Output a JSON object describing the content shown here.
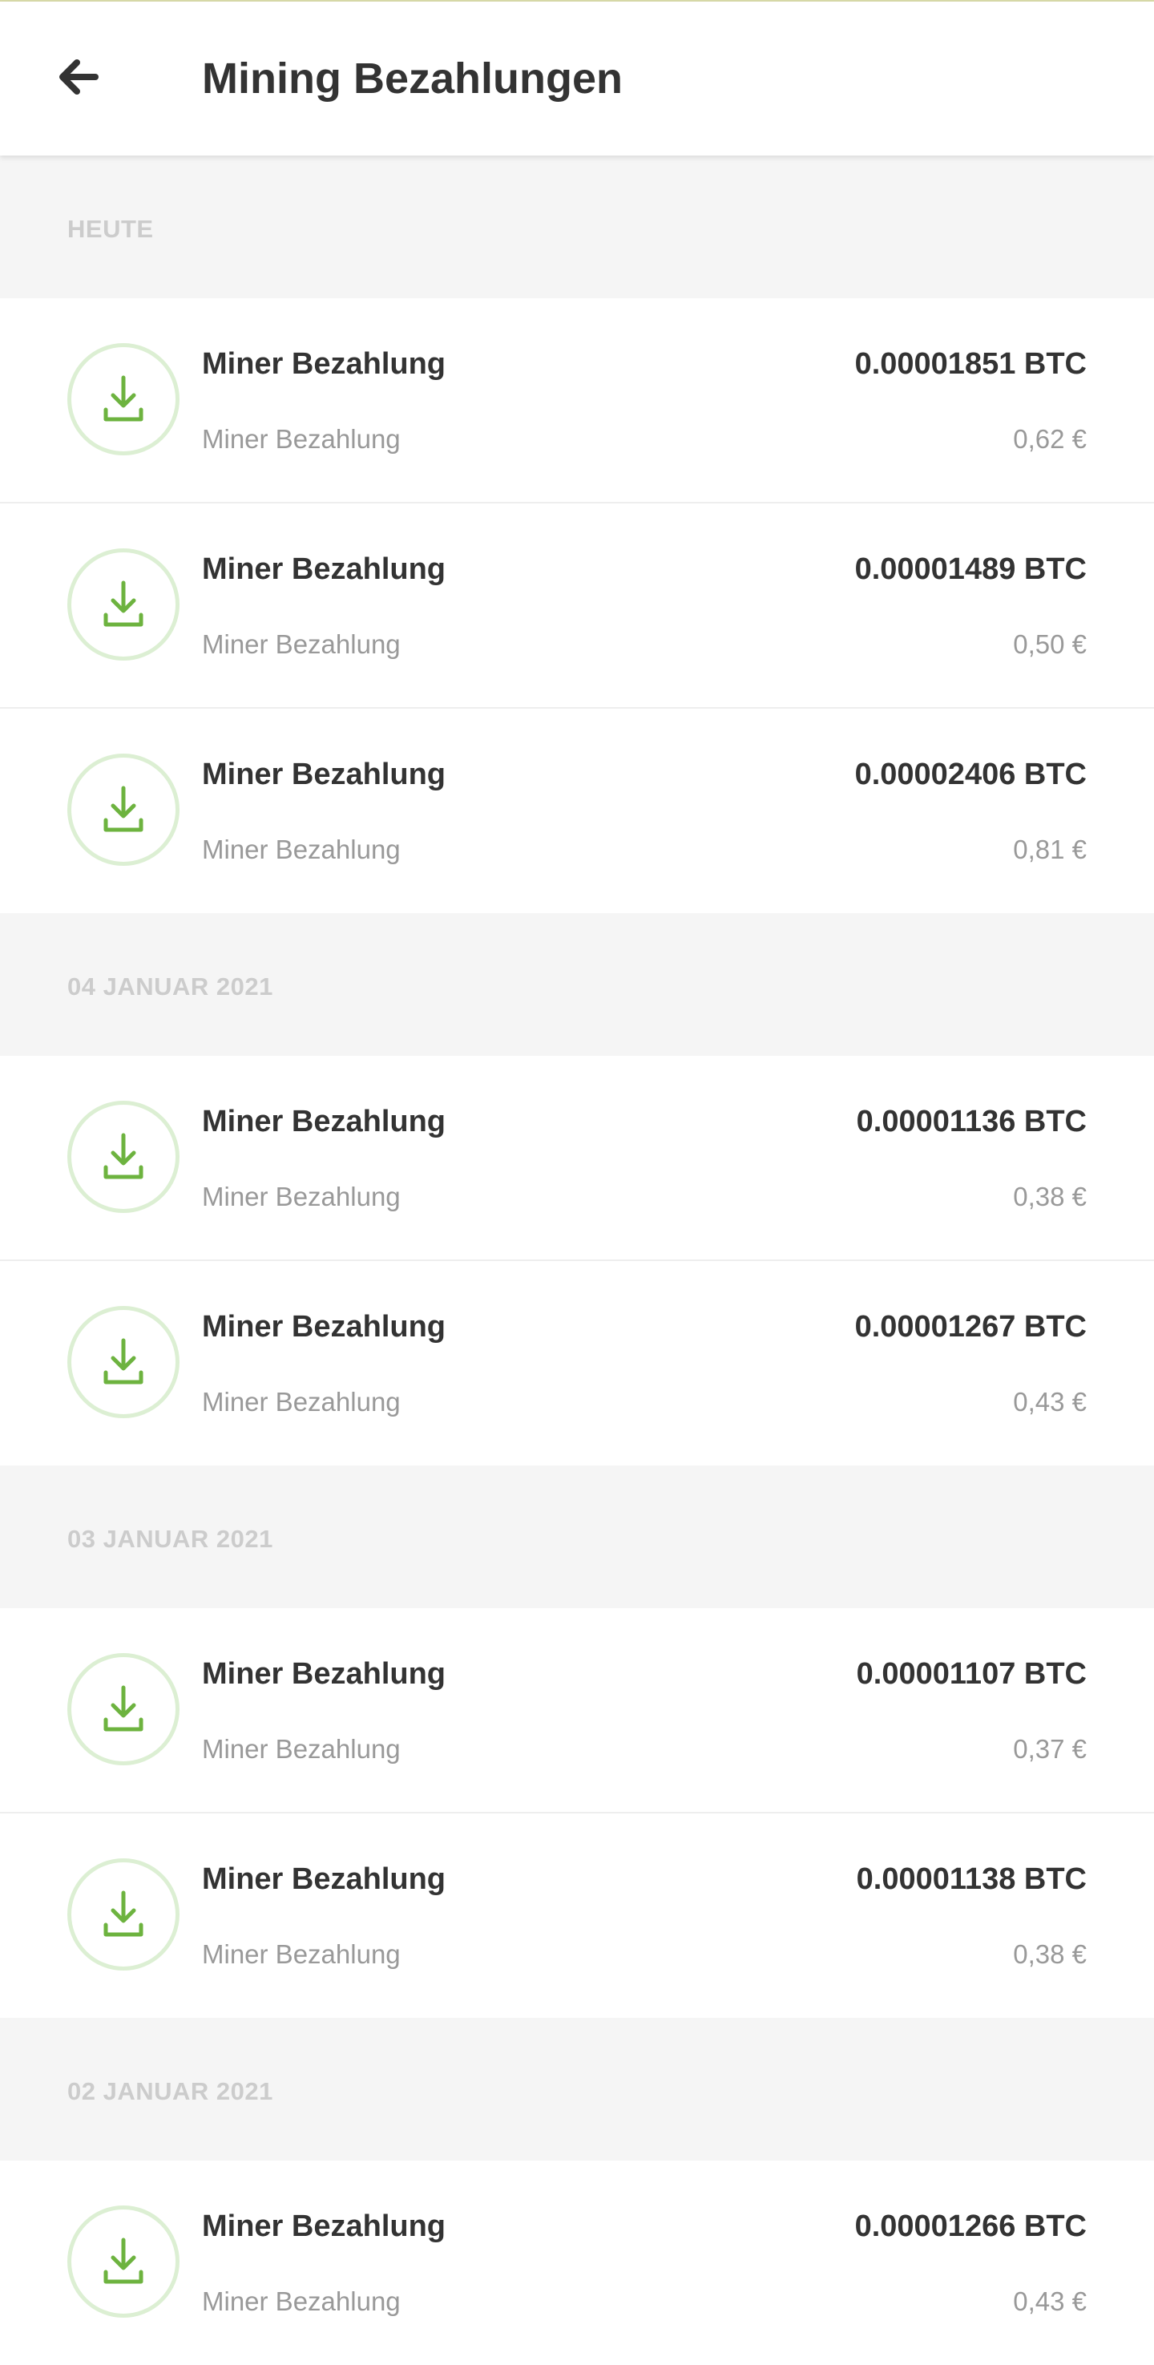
{
  "header": {
    "title": "Mining Bezahlungen",
    "back_icon": "arrow-left-icon"
  },
  "colors": {
    "accent": "#6db33f",
    "icon_ring": "#dcefd3",
    "text_primary": "#333333",
    "text_secondary": "#999999",
    "section_label": "#cccccc",
    "section_bg": "#f5f5f5"
  },
  "sections": [
    {
      "label": "HEUTE",
      "items": [
        {
          "title": "Miner Bezahlung",
          "subtitle": "Miner Bezahlung",
          "amount": "0.00001851 BTC",
          "fiat": "0,62 €",
          "icon": "download-icon"
        },
        {
          "title": "Miner Bezahlung",
          "subtitle": "Miner Bezahlung",
          "amount": "0.00001489 BTC",
          "fiat": "0,50 €",
          "icon": "download-icon"
        },
        {
          "title": "Miner Bezahlung",
          "subtitle": "Miner Bezahlung",
          "amount": "0.00002406 BTC",
          "fiat": "0,81 €",
          "icon": "download-icon"
        }
      ]
    },
    {
      "label": "04 JANUAR 2021",
      "items": [
        {
          "title": "Miner Bezahlung",
          "subtitle": "Miner Bezahlung",
          "amount": "0.00001136 BTC",
          "fiat": "0,38 €",
          "icon": "download-icon"
        },
        {
          "title": "Miner Bezahlung",
          "subtitle": "Miner Bezahlung",
          "amount": "0.00001267 BTC",
          "fiat": "0,43 €",
          "icon": "download-icon"
        }
      ]
    },
    {
      "label": "03 JANUAR 2021",
      "items": [
        {
          "title": "Miner Bezahlung",
          "subtitle": "Miner Bezahlung",
          "amount": "0.00001107 BTC",
          "fiat": "0,37 €",
          "icon": "download-icon"
        },
        {
          "title": "Miner Bezahlung",
          "subtitle": "Miner Bezahlung",
          "amount": "0.00001138 BTC",
          "fiat": "0,38 €",
          "icon": "download-icon"
        }
      ]
    },
    {
      "label": "02 JANUAR 2021",
      "items": [
        {
          "title": "Miner Bezahlung",
          "subtitle": "Miner Bezahlung",
          "amount": "0.00001266 BTC",
          "fiat": "0,43 €",
          "icon": "download-icon"
        }
      ]
    }
  ]
}
